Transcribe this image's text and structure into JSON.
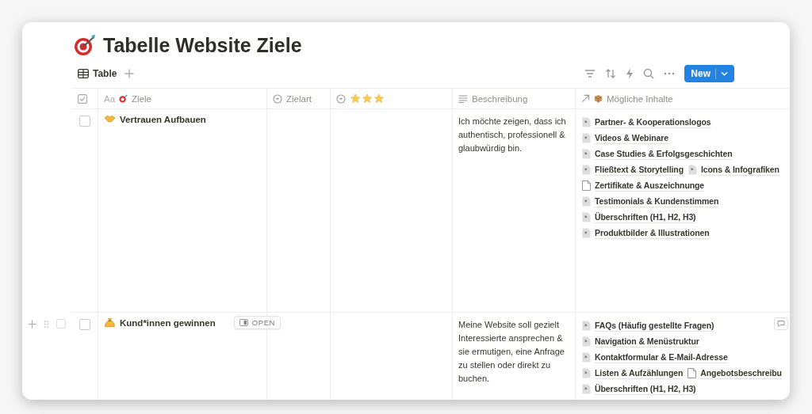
{
  "page": {
    "title": "Tabelle Website Ziele"
  },
  "view_tabs": [
    {
      "label": "Table",
      "selected": true
    }
  ],
  "toolbar": {
    "new_button": "New"
  },
  "columns": [
    {
      "kind": "check"
    },
    {
      "kind": "title",
      "label": "Ziele",
      "prefix": "Aa"
    },
    {
      "kind": "select",
      "label": "Zielart"
    },
    {
      "kind": "stars"
    },
    {
      "kind": "text",
      "label": "Beschreibung"
    },
    {
      "kind": "relation",
      "label": "Mögliche Inhalte"
    }
  ],
  "rows": [
    {
      "checked": false,
      "selected": false,
      "hovered": false,
      "name": "Vertrauen Aufbauen",
      "description": "Ich möchte zeigen, dass ich authentisch, professionell & glaubwürdig bin.",
      "contents": [
        [
          {
            "kind": "image",
            "label": "Partner- & Kooperationslogos"
          }
        ],
        [
          {
            "kind": "image",
            "label": "Videos & Webinare"
          }
        ],
        [
          {
            "kind": "image",
            "label": "Case Studies & Erfolgsgeschichten"
          }
        ],
        [
          {
            "kind": "image",
            "label": "Fließtext & Storytelling"
          },
          {
            "kind": "image",
            "label": "Icons & Infografiken"
          }
        ],
        [
          {
            "kind": "blank",
            "label": "Zertifikate & Auszeichnunge"
          }
        ],
        [
          {
            "kind": "image",
            "label": "Testimonials & Kundenstimmen"
          }
        ],
        [
          {
            "kind": "image",
            "label": "Überschriften (H1, H2, H3)"
          }
        ],
        [
          {
            "kind": "image",
            "label": "Produktbilder & Illustrationen"
          }
        ]
      ]
    },
    {
      "checked": false,
      "selected": false,
      "hovered": true,
      "open_label": "OPEN",
      "name": "Kund*innen gewinnen",
      "description": "Meine Website soll gezielt Interessierte ansprechen & sie ermutigen, eine Anfrage zu stellen oder direkt zu buchen.",
      "contents": [
        [
          {
            "kind": "image",
            "label": "FAQs (Häufig gestellte Fragen)"
          }
        ],
        [
          {
            "kind": "image",
            "label": "Navigation & Menüstruktur"
          }
        ],
        [
          {
            "kind": "image",
            "label": "Kontaktformular & E-Mail-Adresse"
          }
        ],
        [
          {
            "kind": "image",
            "label": "Listen & Aufzählungen"
          },
          {
            "kind": "blank",
            "label": "Angebotsbeschreibu"
          }
        ],
        [
          {
            "kind": "image",
            "label": "Überschriften (H1, H2, H3)"
          }
        ]
      ]
    }
  ]
}
